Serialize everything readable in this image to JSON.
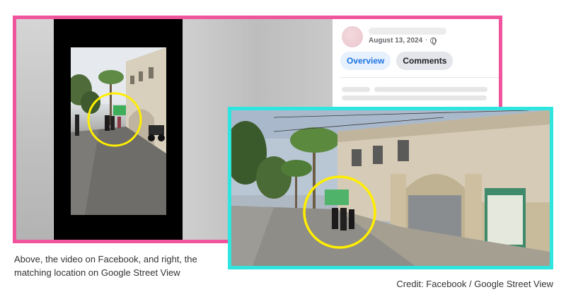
{
  "facebook_post": {
    "date": "August 13, 2024",
    "separator": "·",
    "privacy_icon": "globe-icon",
    "tabs": [
      {
        "label": "Overview",
        "active": true
      },
      {
        "label": "Comments",
        "active": false
      }
    ]
  },
  "frames": {
    "facebook_border_color": "#f0549c",
    "street_view_border_color": "#2ee6df",
    "highlight_circle_color": "#ffee00"
  },
  "caption": {
    "line1": "Above, the video on Facebook, and right, the",
    "line2": "matching location on Google Street View"
  },
  "credit": "Credit: Facebook / Google Street View"
}
